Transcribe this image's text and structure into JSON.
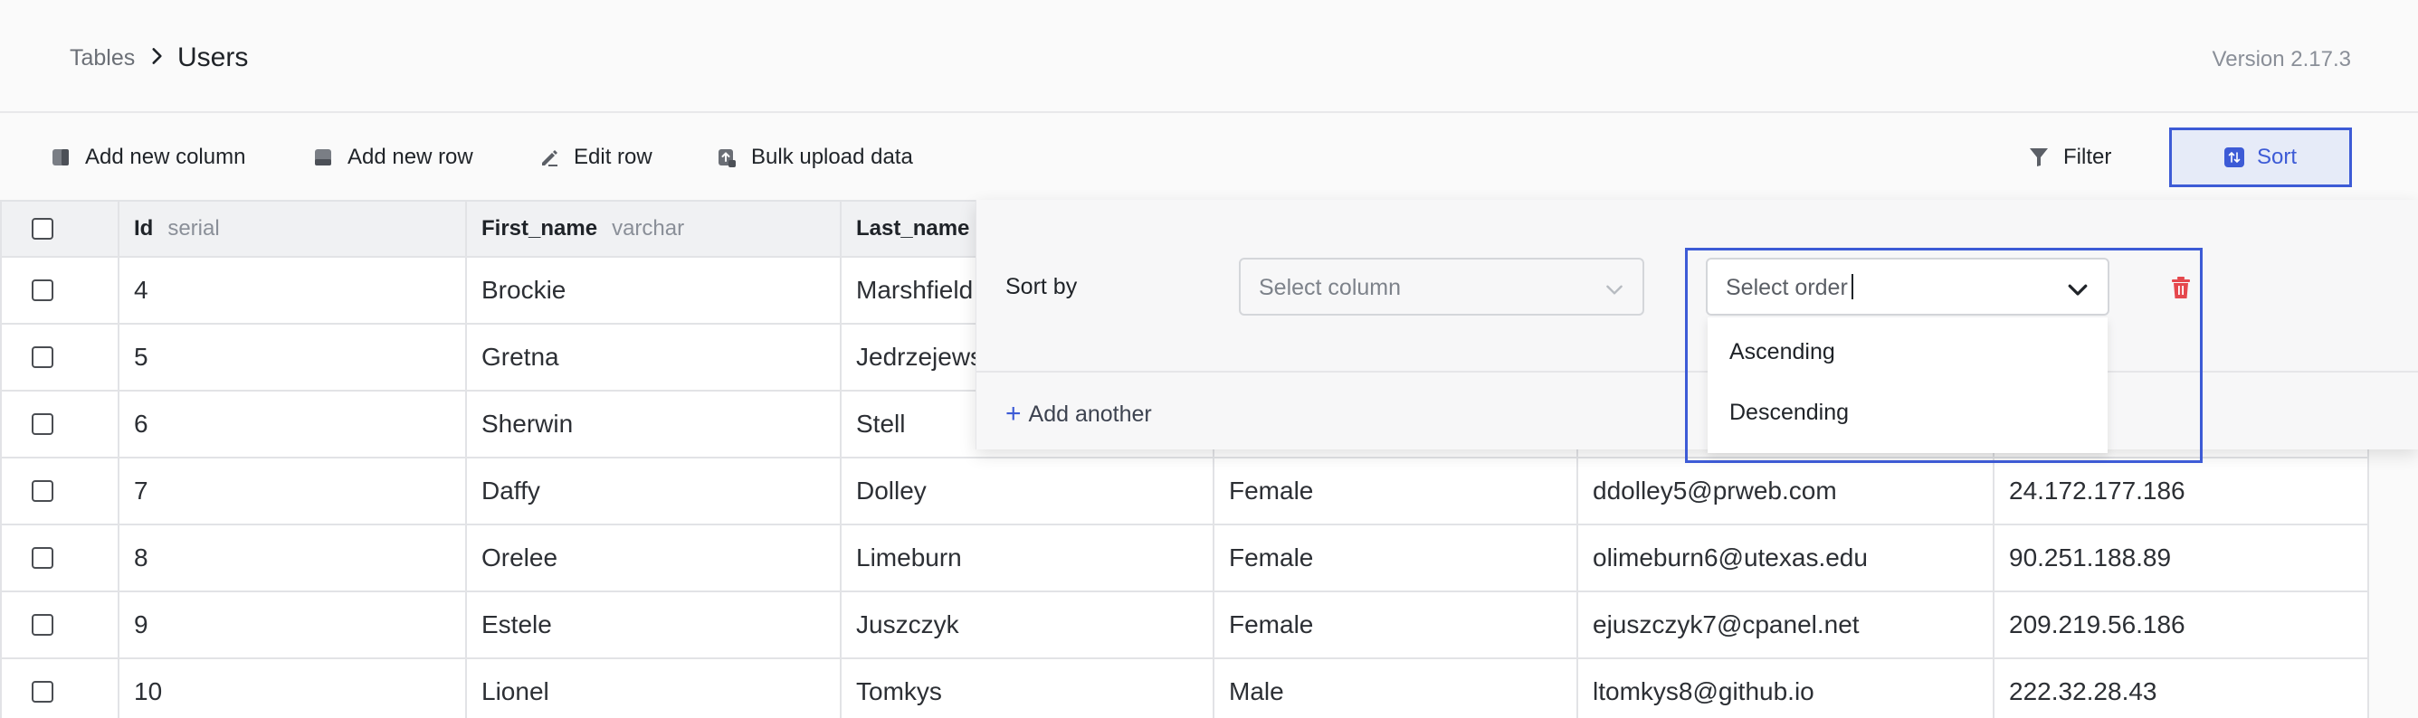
{
  "breadcrumb": {
    "root": "Tables",
    "current": "Users"
  },
  "version": "Version 2.17.3",
  "toolbar": {
    "add_column": "Add new column",
    "add_row": "Add new row",
    "edit_row": "Edit row",
    "bulk_upload": "Bulk upload data",
    "filter": "Filter",
    "sort": "Sort"
  },
  "table": {
    "columns": [
      {
        "name": "Id",
        "type": "serial"
      },
      {
        "name": "First_name",
        "type": "varchar"
      },
      {
        "name": "Last_name",
        "type": ""
      }
    ],
    "rows": [
      [
        "4",
        "Brockie",
        "Marshfield",
        "",
        "",
        ""
      ],
      [
        "5",
        "Gretna",
        "Jedrzejews",
        "",
        "",
        ""
      ],
      [
        "6",
        "Sherwin",
        "Stell",
        "",
        "",
        ""
      ],
      [
        "7",
        "Daffy",
        "Dolley",
        "Female",
        "ddolley5@prweb.com",
        "24.172.177.186"
      ],
      [
        "8",
        "Orelee",
        "Limeburn",
        "Female",
        "olimeburn6@utexas.edu",
        "90.251.188.89"
      ],
      [
        "9",
        "Estele",
        "Juszczyk",
        "Female",
        "ejuszczyk7@cpanel.net",
        "209.219.56.186"
      ],
      [
        "10",
        "Lionel",
        "Tomkys",
        "Male",
        "ltomkys8@github.io",
        "222.32.28.43"
      ]
    ]
  },
  "sort_panel": {
    "sort_by_label": "Sort by",
    "column_placeholder": "Select column",
    "order_placeholder": "Select order",
    "order_options": [
      "Ascending",
      "Descending"
    ],
    "add_another": "Add another"
  },
  "colors": {
    "accent": "#3d5bd6",
    "danger": "#e5484d"
  }
}
